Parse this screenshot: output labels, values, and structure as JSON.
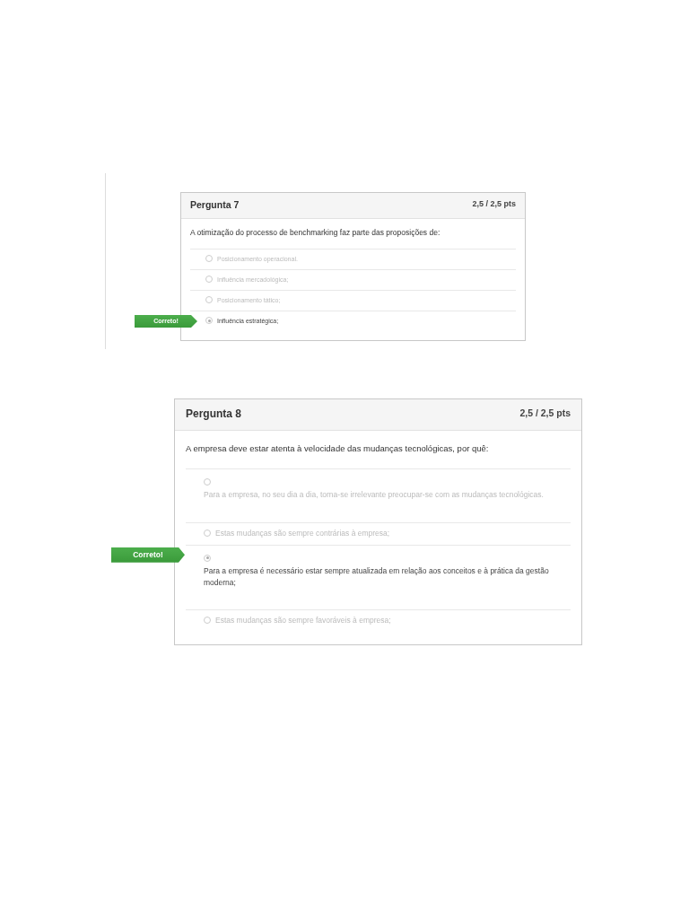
{
  "questions": [
    {
      "title": "Pergunta 7",
      "points": "2,5 / 2,5 pts",
      "text": "A otimização do processo de benchmarking faz parte das proposições de:",
      "options": [
        {
          "label": "Posicionamento operacional.",
          "kind": "inline",
          "selected": false
        },
        {
          "label": "Influência mercadológica;",
          "kind": "inline",
          "selected": false
        },
        {
          "label": "Posicionamento tático;",
          "kind": "inline",
          "selected": false
        },
        {
          "label": "Influência estratégica;",
          "kind": "inline",
          "selected": true,
          "badge": "Correto!"
        }
      ]
    },
    {
      "title": "Pergunta 8",
      "points": "2,5 / 2,5 pts",
      "text": "A empresa deve estar atenta à velocidade das mudanças tecnológicas, por quê:",
      "options": [
        {
          "label": "Para a empresa, no seu dia a dia, torna-se irrelevante preocupar-se com as mudanças tecnológicas.",
          "kind": "stacked",
          "selected": false
        },
        {
          "label": "Estas mudanças são sempre contrárias à empresa;",
          "kind": "inline",
          "selected": false
        },
        {
          "label": "Para a empresa é necessário estar sempre atualizada em relação aos conceitos e à prática da gestão moderna;",
          "kind": "stacked",
          "selected": true,
          "badge": "Correto!"
        },
        {
          "label": "Estas mudanças são sempre favoráveis à empresa;",
          "kind": "inline",
          "selected": false
        }
      ]
    }
  ]
}
